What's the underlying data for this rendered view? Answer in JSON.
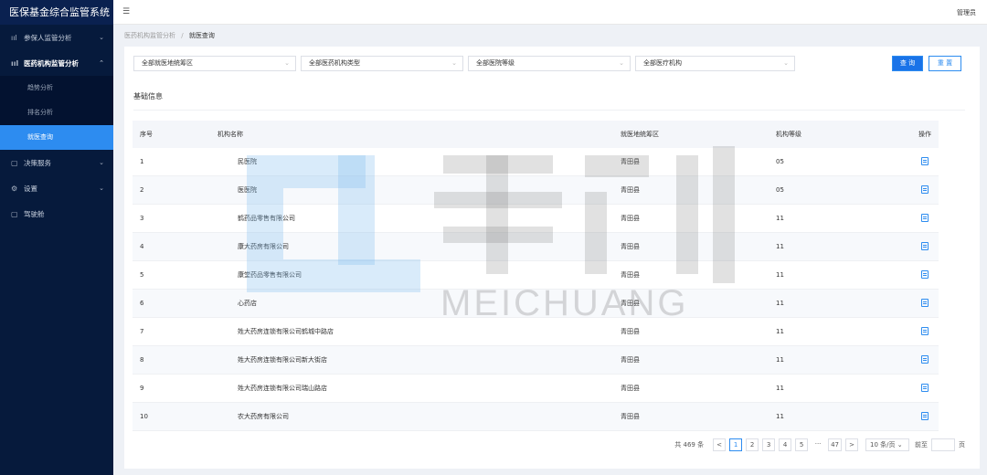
{
  "app": {
    "title": "医保基金综合监管系统"
  },
  "header": {
    "menu_icon": "hamburger-icon",
    "user": "管理员"
  },
  "sidebar": {
    "items": [
      {
        "label": "参保人监管分析",
        "icon": "bar-chart-icon",
        "expanded": false
      },
      {
        "label": "医药机构监管分析",
        "icon": "bar-chart-icon",
        "expanded": true,
        "children": [
          {
            "label": "趋势分析",
            "active": false
          },
          {
            "label": "排名分析",
            "active": false
          },
          {
            "label": "就医查询",
            "active": true
          }
        ]
      },
      {
        "label": "决策服务",
        "icon": "document-icon",
        "expanded": false
      },
      {
        "label": "设置",
        "icon": "gear-icon",
        "expanded": false
      },
      {
        "label": "驾驶舱",
        "icon": "document-icon",
        "expanded": false
      }
    ]
  },
  "breadcrumb": {
    "parent": "医药机构监管分析",
    "separator": "/",
    "current": "就医查询"
  },
  "filters": [
    {
      "value": "全部就医地统筹区"
    },
    {
      "value": "全部医药机构类型"
    },
    {
      "value": "全部医院等级"
    },
    {
      "value": "全部医疗机构"
    }
  ],
  "buttons": {
    "query": "查 询",
    "reset": "重 置"
  },
  "section": {
    "title": "基础信息"
  },
  "table": {
    "columns": [
      "序号",
      "机构名称",
      "就医地统筹区",
      "机构等级",
      "操作"
    ],
    "rows": [
      {
        "no": "1",
        "name": "民医院",
        "area": "青田县",
        "level": "05"
      },
      {
        "no": "2",
        "name": "医医院",
        "area": "青田县",
        "level": "05"
      },
      {
        "no": "3",
        "name": "鹤药品零售有限公司",
        "area": "青田县",
        "level": "11"
      },
      {
        "no": "4",
        "name": "康大药房有限公司",
        "area": "青田县",
        "level": "11"
      },
      {
        "no": "5",
        "name": "康堂药品零售有限公司",
        "area": "青田县",
        "level": "11"
      },
      {
        "no": "6",
        "name": "心药店",
        "area": "青田县",
        "level": "11"
      },
      {
        "no": "7",
        "name": "姓大药房连锁有限公司鹤城中路店",
        "area": "青田县",
        "level": "11"
      },
      {
        "no": "8",
        "name": "姓大药房连锁有限公司新大街店",
        "area": "青田县",
        "level": "11"
      },
      {
        "no": "9",
        "name": "姓大药房连锁有限公司瑞山路店",
        "area": "青田县",
        "level": "11"
      },
      {
        "no": "10",
        "name": "农大药房有限公司",
        "area": "青田县",
        "level": "11"
      }
    ]
  },
  "pagination": {
    "total": "共 469 条",
    "pages": [
      "1",
      "2",
      "3",
      "4",
      "5",
      "···",
      "47"
    ],
    "current": "1",
    "prev": "<",
    "next": ">",
    "page_size": "10 条/页",
    "jump_label": "前至",
    "page_label": "页"
  },
  "watermark": {
    "text": "MEICHUANG",
    "logo": "美创"
  },
  "colors": {
    "sidebar_bg": "#061a3c",
    "accent": "#2d8cf0",
    "active_menu": "#2d8cf0"
  }
}
